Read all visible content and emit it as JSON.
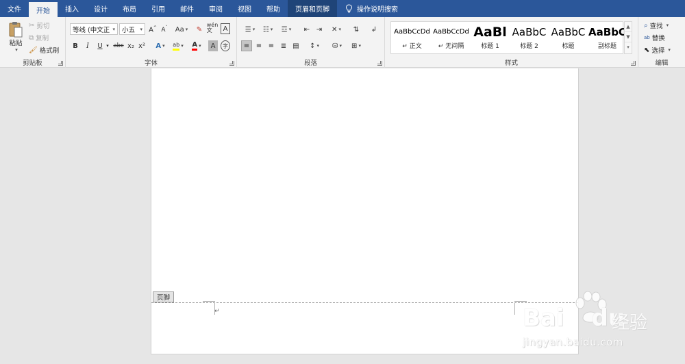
{
  "tabs": [
    {
      "label": "文件",
      "active": false
    },
    {
      "label": "开始",
      "active": true
    },
    {
      "label": "插入",
      "active": false
    },
    {
      "label": "设计",
      "active": false
    },
    {
      "label": "布局",
      "active": false
    },
    {
      "label": "引用",
      "active": false
    },
    {
      "label": "邮件",
      "active": false
    },
    {
      "label": "审阅",
      "active": false
    },
    {
      "label": "视图",
      "active": false
    },
    {
      "label": "帮助",
      "active": false
    },
    {
      "label": "页眉和页脚",
      "active": false,
      "contextual": true
    }
  ],
  "tell_me": "操作说明搜索",
  "clipboard": {
    "paste": "粘贴",
    "cut": "剪切",
    "copy": "复制",
    "format_painter": "格式刷",
    "label": "剪贴板"
  },
  "font": {
    "font_name": "等线 (中文正",
    "font_size": "小五",
    "label": "字体",
    "change_case": "Aa",
    "bold": "B",
    "italic": "I",
    "underline": "U",
    "strikethrough": "abc",
    "subscript": "x₂",
    "superscript": "x²",
    "highlight_color": "#ffff00",
    "font_color": "#ff0000"
  },
  "paragraph": {
    "label": "段落"
  },
  "styles": {
    "label": "样式",
    "items": [
      {
        "sample": "AaBbCcDd",
        "name": "↵ 正文"
      },
      {
        "sample": "AaBbCcDd",
        "name": "↵ 无间隔"
      },
      {
        "sample": "AaBl",
        "name": "标题 1"
      },
      {
        "sample": "AaBbC",
        "name": "标题 2"
      },
      {
        "sample": "AaBbC",
        "name": "标题"
      },
      {
        "sample": "AaBbC",
        "name": "副标题"
      }
    ]
  },
  "editing": {
    "find": "查找",
    "replace": "替换",
    "select": "选择",
    "label": "编辑"
  },
  "document": {
    "footer_tag": "页脚",
    "paragraph_mark": "↵"
  },
  "watermark": {
    "brand": "Bai",
    "brand2": "du",
    "cn": "经验",
    "url": "jingyan.baidu.com"
  },
  "colors": {
    "tab_bar": "#2b579a",
    "ribbon": "#f3f3f3",
    "canvas": "#e6e6e6"
  }
}
